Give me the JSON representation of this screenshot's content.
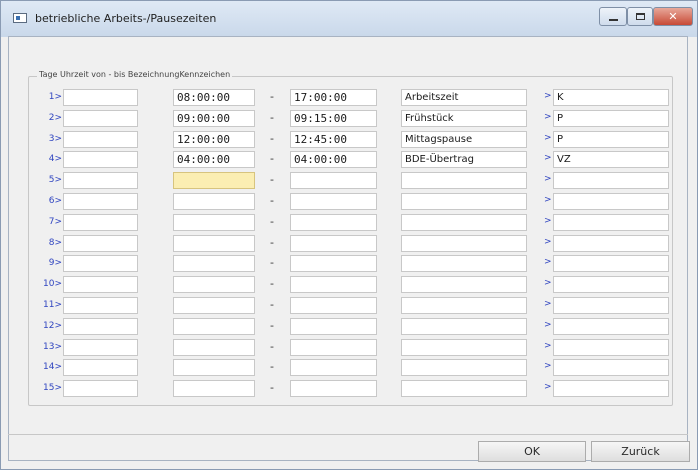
{
  "window": {
    "title": "betriebliche Arbeits-/Pausezeiten"
  },
  "group": {
    "title": "Tage Uhrzeit von - bis BezeichnungKennzeichen"
  },
  "separator": "-",
  "arrow": ">",
  "rows": [
    {
      "num": "1",
      "tage": "",
      "von": "08:00:00",
      "bis": "17:00:00",
      "bezeichnung": "Arbeitszeit",
      "kennzeichen": "K"
    },
    {
      "num": "2",
      "tage": "",
      "von": "09:00:00",
      "bis": "09:15:00",
      "bezeichnung": "Frühstück",
      "kennzeichen": "P"
    },
    {
      "num": "3",
      "tage": "",
      "von": "12:00:00",
      "bis": "12:45:00",
      "bezeichnung": "Mittagspause",
      "kennzeichen": "P"
    },
    {
      "num": "4",
      "tage": "",
      "von": "04:00:00",
      "bis": "04:00:00",
      "bezeichnung": "BDE-Übertrag",
      "kennzeichen": "VZ"
    },
    {
      "num": "5",
      "tage": "",
      "von": "",
      "bis": "",
      "bezeichnung": "",
      "kennzeichen": ""
    },
    {
      "num": "6",
      "tage": "",
      "von": "",
      "bis": "",
      "bezeichnung": "",
      "kennzeichen": ""
    },
    {
      "num": "7",
      "tage": "",
      "von": "",
      "bis": "",
      "bezeichnung": "",
      "kennzeichen": ""
    },
    {
      "num": "8",
      "tage": "",
      "von": "",
      "bis": "",
      "bezeichnung": "",
      "kennzeichen": ""
    },
    {
      "num": "9",
      "tage": "",
      "von": "",
      "bis": "",
      "bezeichnung": "",
      "kennzeichen": ""
    },
    {
      "num": "10",
      "tage": "",
      "von": "",
      "bis": "",
      "bezeichnung": "",
      "kennzeichen": ""
    },
    {
      "num": "11",
      "tage": "",
      "von": "",
      "bis": "",
      "bezeichnung": "",
      "kennzeichen": ""
    },
    {
      "num": "12",
      "tage": "",
      "von": "",
      "bis": "",
      "bezeichnung": "",
      "kennzeichen": ""
    },
    {
      "num": "13",
      "tage": "",
      "von": "",
      "bis": "",
      "bezeichnung": "",
      "kennzeichen": ""
    },
    {
      "num": "14",
      "tage": "",
      "von": "",
      "bis": "",
      "bezeichnung": "",
      "kennzeichen": ""
    },
    {
      "num": "15",
      "tage": "",
      "von": "",
      "bis": "",
      "bezeichnung": "",
      "kennzeichen": ""
    }
  ],
  "buttons": {
    "ok": "OK",
    "cancel": "Zurück"
  },
  "colors": {
    "row_number": "#3045c0",
    "focused_field": "#fbeeb2",
    "close_button": "#c74a36"
  }
}
